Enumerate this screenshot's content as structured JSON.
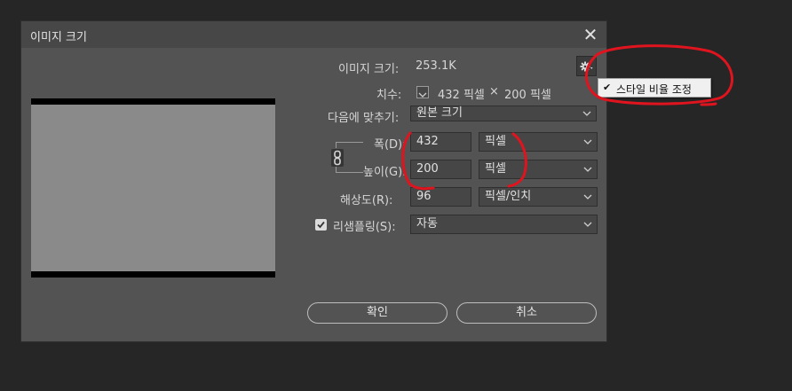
{
  "dialog": {
    "title": "이미지 크기",
    "close_label": "✕"
  },
  "info": {
    "image_size_label": "이미지 크기:",
    "image_size_value": "253.1K",
    "dimensions_label": "치수:",
    "dimensions_width": "432 픽셀",
    "dimensions_times": "×",
    "dimensions_height": "200 픽셀"
  },
  "fit_to": {
    "label": "다음에 맞추기:",
    "value": "원본 크기"
  },
  "width": {
    "label": "폭(D):",
    "value": "432",
    "unit": "픽셀"
  },
  "height": {
    "label": "높이(G):",
    "value": "200",
    "unit": "픽셀"
  },
  "resolution": {
    "label": "해상도(R):",
    "value": "96",
    "unit": "픽셀/인치"
  },
  "resample": {
    "label": "리샘플링(S):",
    "value": "자동",
    "checked": true
  },
  "buttons": {
    "ok": "확인",
    "cancel": "취소"
  },
  "gear_menu": {
    "item_check": "✔",
    "item_label": "스타일 비율 조정"
  },
  "icons": {
    "gear": "gear-icon",
    "link": "link-icon",
    "chevron": "chevron-down-icon"
  },
  "colors": {
    "dialog_bg": "#535353",
    "annotation": "#e0141e"
  }
}
